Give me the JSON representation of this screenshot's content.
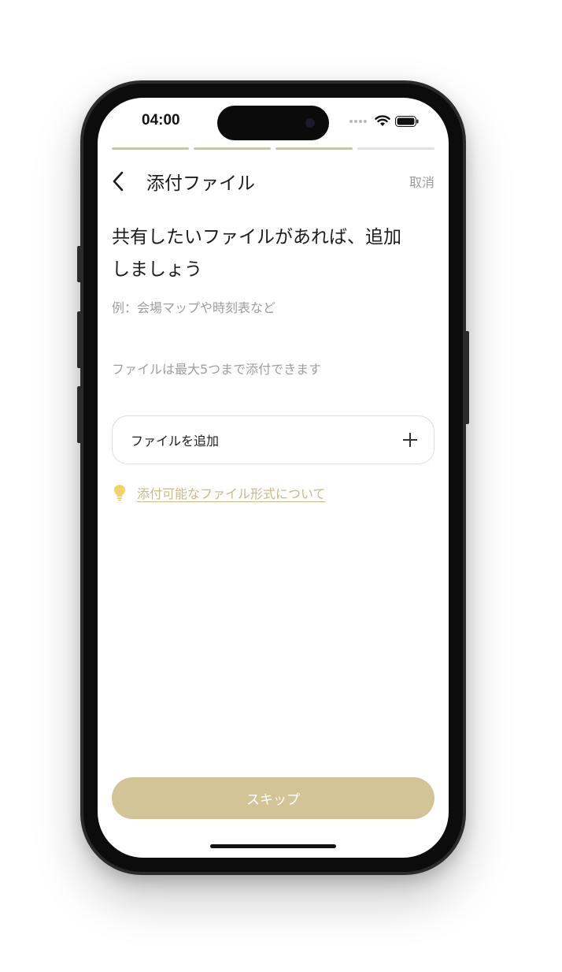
{
  "status_bar": {
    "time": "04:00"
  },
  "progress": {
    "total_steps": 4,
    "completed_steps": 3
  },
  "header": {
    "back_icon": "chevron-left-icon",
    "title": "添付ファイル",
    "cancel_label": "取消"
  },
  "main": {
    "headline_line1": "共有したいファイルがあれば、追加",
    "headline_line2": "しましょう",
    "example": "例：会場マップや時刻表など",
    "limit_note": "ファイルは最大5つまで添付できます",
    "add_file_label": "ファイルを追加",
    "add_file_icon": "plus-icon",
    "hint_icon": "lightbulb-icon",
    "hint_link": "添付可能なファイル形式について"
  },
  "footer": {
    "skip_label": "スキップ"
  },
  "colors": {
    "accent": "#d3c497",
    "link": "#c9b888",
    "muted_text": "#9e9e9e",
    "primary_text": "#1c1c1c"
  }
}
